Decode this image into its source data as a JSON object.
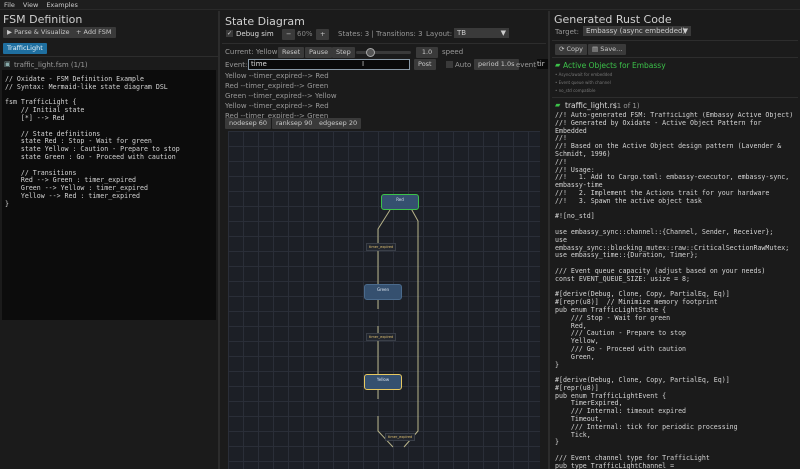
{
  "menu": [
    "File",
    "View",
    "Examples"
  ],
  "left": {
    "title": "FSM Definition",
    "parse_label": "▶ Parse & Visualize",
    "add_label": "+ Add FSM",
    "fsm_tab": "TrafficLight",
    "file_label": "traffic_light.fsm  (1/1)",
    "code": "// Oxidate - FSM Definition Example\n// Syntax: Mermaid-like state diagram DSL\n\nfsm TrafficLight {\n    // Initial state\n    [*] --> Red\n\n    // State definitions\n    state Red : Stop - Wait for green\n    state Yellow : Caution - Prepare to stop\n    state Green : Go - Proceed with caution\n\n    // Transitions\n    Red --> Green : timer_expired\n    Green --> Yellow : timer_expired\n    Yellow --> Red : timer_expired\n}"
  },
  "middle": {
    "title": "State Diagram",
    "debug_label": "Debug sim",
    "debug_checked": true,
    "zoom_minus": "−",
    "zoom": "60%",
    "zoom_plus": "+",
    "stats": "States: 3 | Transitions: 3",
    "layout_label": "Layout:",
    "layout_value": "TB",
    "current": "Current: Yellow",
    "reset": "Reset",
    "pause": "Pause",
    "step": "Step",
    "speed_value": "1.0",
    "speed_label": "speed",
    "speed_fraction": 0.25,
    "event_label": "Event:",
    "event_value": "time",
    "post": "Post",
    "auto_label": "Auto",
    "auto_checked": false,
    "period": "period 1.0s",
    "event2_label": "event",
    "event2_value": "tir",
    "log": [
      "Yellow --timer_expired--> Red",
      "Red --timer_expired--> Green",
      "Green --timer_expired--> Yellow",
      "Yellow --timer_expired--> Red",
      "Red --timer_expired--> Green"
    ],
    "nodesep": "nodesep 60",
    "ranksep": "ranksep 90",
    "edgesep": "edgesep 20",
    "nodes": [
      "Red",
      "Green",
      "Yellow"
    ],
    "edge_label": "timer_expired"
  },
  "right": {
    "title": "Generated Rust Code",
    "target_label": "Target:",
    "target_value": "Embassy (async embedded)",
    "copy": "Copy",
    "save": "Save...",
    "banner_title": "Active Objects for Embassy",
    "bullets": [
      "• Async/await for embedded",
      "• Event queue with channel",
      "• no_std compatible"
    ],
    "file_label": "traffic_light.rs",
    "file_count": "(1 of 1)",
    "code": "//! Auto-generated FSM: TrafficLight (Embassy Active Object)\n//! Generated by Oxidate - Active Object Pattern for\nEmbedded\n//!\n//! Based on the Active Object design pattern (Lavender &\nSchmidt, 1996)\n//!\n//! Usage:\n//!   1. Add to Cargo.toml: embassy-executor, embassy-sync,\nembassy-time\n//!   2. Implement the Actions trait for your hardware\n//!   3. Spawn the active object task\n\n#![no_std]\n\nuse embassy_sync::channel::{Channel, Sender, Receiver};\nuse\nembassy_sync::blocking_mutex::raw::CriticalSectionRawMutex;\nuse embassy_time::{Duration, Timer};\n\n/// Event queue capacity (adjust based on your needs)\nconst EVENT_QUEUE_SIZE: usize = 8;\n\n#[derive(Debug, Clone, Copy, PartialEq, Eq)]\n#[repr(u8)]  // Minimize memory footprint\npub enum TrafficLightState {\n    /// Stop - Wait for green\n    Red,\n    /// Caution - Prepare to stop\n    Yellow,\n    /// Go - Proceed with caution\n    Green,\n}\n\n#[derive(Debug, Clone, Copy, PartialEq, Eq)]\n#[repr(u8)]\npub enum TrafficLightEvent {\n    TimerExpired,\n    /// Internal: timeout expired\n    Timeout,\n    /// Internal: tick for periodic processing\n    Tick,\n}\n\n/// Event channel type for TrafficLight\npub type TrafficLightChannel ="
  },
  "colors": {
    "accent": "#1f6fa0",
    "green": "#3cc24a",
    "yellow": "#e8c860"
  }
}
